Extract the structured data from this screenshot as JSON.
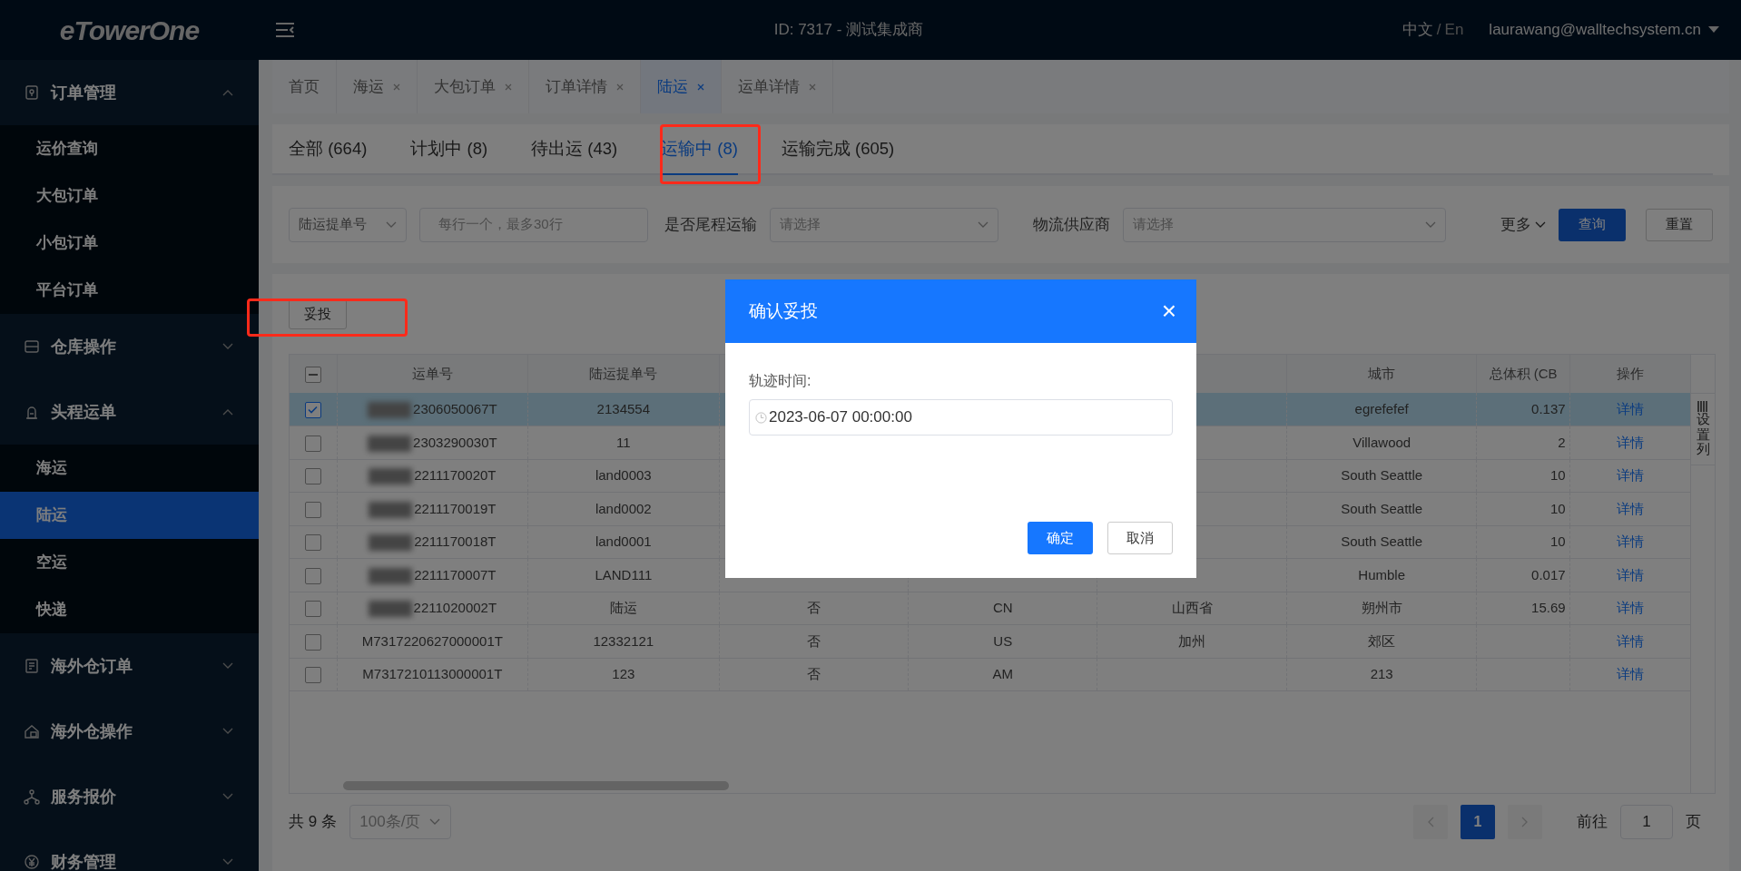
{
  "topbar": {
    "logo": "eTowerOne",
    "title": "ID: 7317 - 测试集成商",
    "lang_zh": "中文",
    "lang_sep": "/",
    "lang_en": "En",
    "user": "laurawang@walltechsystem.cn"
  },
  "sidebar": {
    "groups": [
      {
        "label": "订单管理",
        "kind": "lock",
        "expanded": true,
        "children": [
          {
            "label": "运价查询",
            "selected": false
          },
          {
            "label": "大包订单",
            "selected": false
          },
          {
            "label": "小包订单",
            "selected": false
          },
          {
            "label": "平台订单",
            "selected": false
          }
        ]
      },
      {
        "label": "仓库操作",
        "kind": "drawer",
        "expanded": false
      },
      {
        "label": "头程运单",
        "kind": "person",
        "expanded": true,
        "children": [
          {
            "label": "海运",
            "selected": false
          },
          {
            "label": "陆运",
            "selected": true
          },
          {
            "label": "空运",
            "selected": false
          },
          {
            "label": "快递",
            "selected": false
          }
        ]
      },
      {
        "label": "海外仓订单",
        "kind": "doc",
        "expanded": false
      },
      {
        "label": "海外仓操作",
        "kind": "house",
        "expanded": false
      },
      {
        "label": "服务报价",
        "kind": "network",
        "expanded": false
      },
      {
        "label": "财务管理",
        "kind": "yen",
        "expanded": false
      }
    ]
  },
  "page_tabs": [
    {
      "label": "首页",
      "closable": false,
      "selected": false
    },
    {
      "label": "海运",
      "closable": true,
      "selected": false
    },
    {
      "label": "大包订单",
      "closable": true,
      "selected": false
    },
    {
      "label": "订单详情",
      "closable": true,
      "selected": false
    },
    {
      "label": "陆运",
      "closable": true,
      "selected": true
    },
    {
      "label": "运单详情",
      "closable": true,
      "selected": false
    }
  ],
  "status_tabs": [
    {
      "label": "全部 (664)",
      "selected": false
    },
    {
      "label": "计划中 (8)",
      "selected": false
    },
    {
      "label": "待出运 (43)",
      "selected": false
    },
    {
      "label": "运输中 (8)",
      "selected": true
    },
    {
      "label": "运输完成 (605)",
      "selected": false
    }
  ],
  "filters": {
    "field_select": "陆运提单号",
    "numbers_placeholder": "每行一个，最多30行",
    "last_mile_label": "是否尾程运输",
    "last_mile_placeholder": "请选择",
    "supplier_label": "物流供应商",
    "supplier_placeholder": "请选择",
    "more": "更多",
    "search": "查询",
    "reset": "重置"
  },
  "toolbar": {
    "deliver": "妥投"
  },
  "table": {
    "columns": [
      {
        "label": "运单号"
      },
      {
        "label": "陆运提单号"
      },
      {},
      {},
      {},
      {
        "label": "城市"
      },
      {
        "label": "总体积 (CB"
      },
      {
        "label": "操作"
      }
    ],
    "settings": "设置列",
    "select_all_partial": true,
    "rows": [
      {
        "selected": true,
        "redacted": true,
        "cells": [
          "2306050067T",
          "2134554",
          null,
          null,
          null,
          "egrefefef",
          "0.137",
          "详情"
        ]
      },
      {
        "selected": false,
        "redacted": true,
        "cells": [
          "2303290030T",
          "11",
          null,
          null,
          null,
          "Villawood",
          "2",
          "详情"
        ]
      },
      {
        "selected": false,
        "redacted": true,
        "cells": [
          "2211170020T",
          "land0003",
          null,
          null,
          null,
          "South Seattle",
          "10",
          "详情"
        ]
      },
      {
        "selected": false,
        "redacted": true,
        "cells": [
          "2211170019T",
          "land0002",
          null,
          null,
          null,
          "South Seattle",
          "10",
          "详情"
        ]
      },
      {
        "selected": false,
        "redacted": true,
        "cells": [
          "2211170018T",
          "land0001",
          null,
          null,
          null,
          "South Seattle",
          "10",
          "详情"
        ]
      },
      {
        "selected": false,
        "redacted": true,
        "cells": [
          "2211170007T",
          "LAND111",
          null,
          null,
          null,
          "Humble",
          "0.017",
          "详情"
        ]
      },
      {
        "selected": false,
        "redacted": true,
        "cells": [
          "2211020002T",
          "陆运",
          "否",
          "CN",
          "山西省",
          "朔州市",
          "15.69",
          "详情"
        ]
      },
      {
        "selected": false,
        "redacted": false,
        "cells": [
          "M7317220627000001T",
          "12332121",
          "否",
          "US",
          "加州",
          "郊区",
          null,
          "详情"
        ]
      },
      {
        "selected": false,
        "redacted": false,
        "cells": [
          "M7317210113000001T",
          "123",
          "否",
          "AM",
          null,
          "213",
          null,
          "详情"
        ]
      }
    ]
  },
  "pagination": {
    "total": "共 9 条",
    "page_size": "100条/页",
    "current": "1",
    "goto_label": "前往",
    "goto_value": "1",
    "goto_unit": "页"
  },
  "modal": {
    "title": "确认妥投",
    "close": "×",
    "label": "轨迹时间:",
    "value": "2023-06-07 00:00:00",
    "confirm": "确定",
    "cancel": "取消"
  }
}
